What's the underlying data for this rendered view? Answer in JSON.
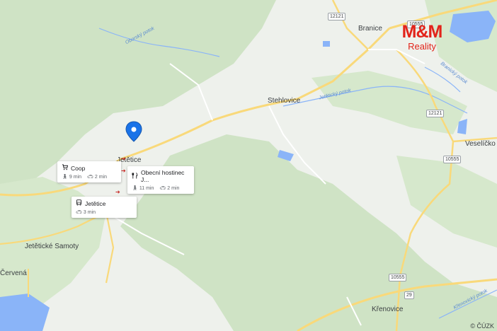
{
  "map": {
    "towns": {
      "branice": "Branice",
      "stehlovice": "Stehlovice",
      "veselicko": "Veselíčko",
      "jeteticke_samoty": "Jetětické Samoty",
      "jetetice": "Jetětice",
      "krenovice": "Křenovice",
      "cervena": "Červená"
    },
    "water": {
      "obora": "Oborský potok",
      "jetetice_potok": "Jetětický potok",
      "branicky_potok": "Branický potok",
      "krenovicky_potok": "Křenovický potok"
    },
    "roads": {
      "r12121_north": "12121",
      "r10555_north": "10555",
      "r12121_east": "12121",
      "r10555_east": "10555",
      "r10555_south": "10555",
      "r29": "29"
    },
    "colors": {
      "background": "#eef1ec",
      "forest": "#cfe3c5",
      "water": "#8ab4f8",
      "road_major": "#f9d97a",
      "road_minor": "#ffffff",
      "pin": "#1a73e8"
    }
  },
  "pins": {
    "location_pin": "location-pin-icon"
  },
  "cards": {
    "coop": {
      "name": "Coop",
      "icon": "cart-icon",
      "walk": "9 min",
      "drive": "2 min"
    },
    "restaurant": {
      "name": "Obecní hostinec J...",
      "icon": "fork-knife-icon",
      "walk": "11 min",
      "drive": "2 min"
    },
    "bus": {
      "name": "Jetětice",
      "icon": "bus-icon",
      "drive": "3 min"
    }
  },
  "logo": {
    "brand": "M&M",
    "sub": "Reality"
  },
  "attribution": "© ČÚZK"
}
